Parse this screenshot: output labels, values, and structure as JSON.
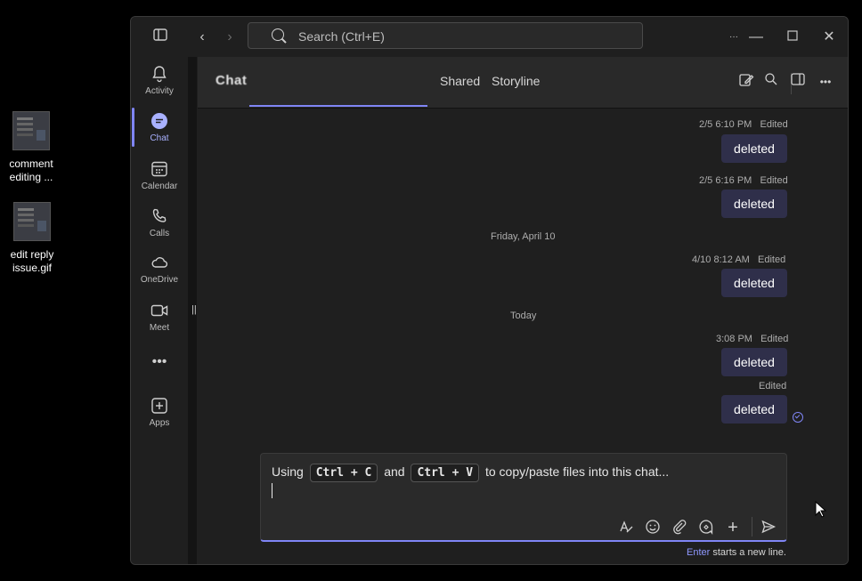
{
  "desktop": {
    "icons": [
      {
        "label": "comment editing ..."
      },
      {
        "label": "edit reply issue.gif"
      }
    ]
  },
  "titlebar": {
    "search_placeholder": "Search (Ctrl+E)"
  },
  "rail": {
    "items": [
      {
        "label": "Activity",
        "icon": "bell-icon"
      },
      {
        "label": "Chat",
        "icon": "chat-icon",
        "active": true
      },
      {
        "label": "Calendar",
        "icon": "calendar-icon"
      },
      {
        "label": "Calls",
        "icon": "phone-icon"
      },
      {
        "label": "OneDrive",
        "icon": "cloud-icon"
      },
      {
        "label": "Meet",
        "icon": "video-icon"
      },
      {
        "label": "",
        "icon": "more-icon"
      },
      {
        "label": "Apps",
        "icon": "apps-icon"
      }
    ]
  },
  "header": {
    "title": "Chat",
    "tabs": [
      {
        "label": "Shared"
      },
      {
        "label": "Storyline"
      }
    ]
  },
  "messages": [
    {
      "time": "2/5 6:10 PM",
      "status": "Edited",
      "text": "deleted"
    },
    {
      "time": "2/5 6:16 PM",
      "status": "Edited",
      "text": "deleted"
    },
    {
      "divider": "Friday, April 10"
    },
    {
      "time": "4/10 8:12 AM",
      "status": "Edited",
      "text": "deleted"
    },
    {
      "divider": "Today"
    },
    {
      "time": "3:08 PM",
      "status": "Edited",
      "text": "deleted"
    },
    {
      "time": "",
      "status": "Edited",
      "text": "deleted",
      "seen": true
    }
  ],
  "composer": {
    "text_prefix": "Using",
    "key1": "Ctrl + C",
    "text_mid": "and",
    "key2": "Ctrl + V",
    "text_suffix": "to copy/paste files into this chat...",
    "hint_key": "Enter",
    "hint_text": " starts a new line."
  },
  "colors": {
    "accent": "#7f85f5",
    "bubble": "#2f2f4a",
    "background": "#1f1f1f"
  }
}
